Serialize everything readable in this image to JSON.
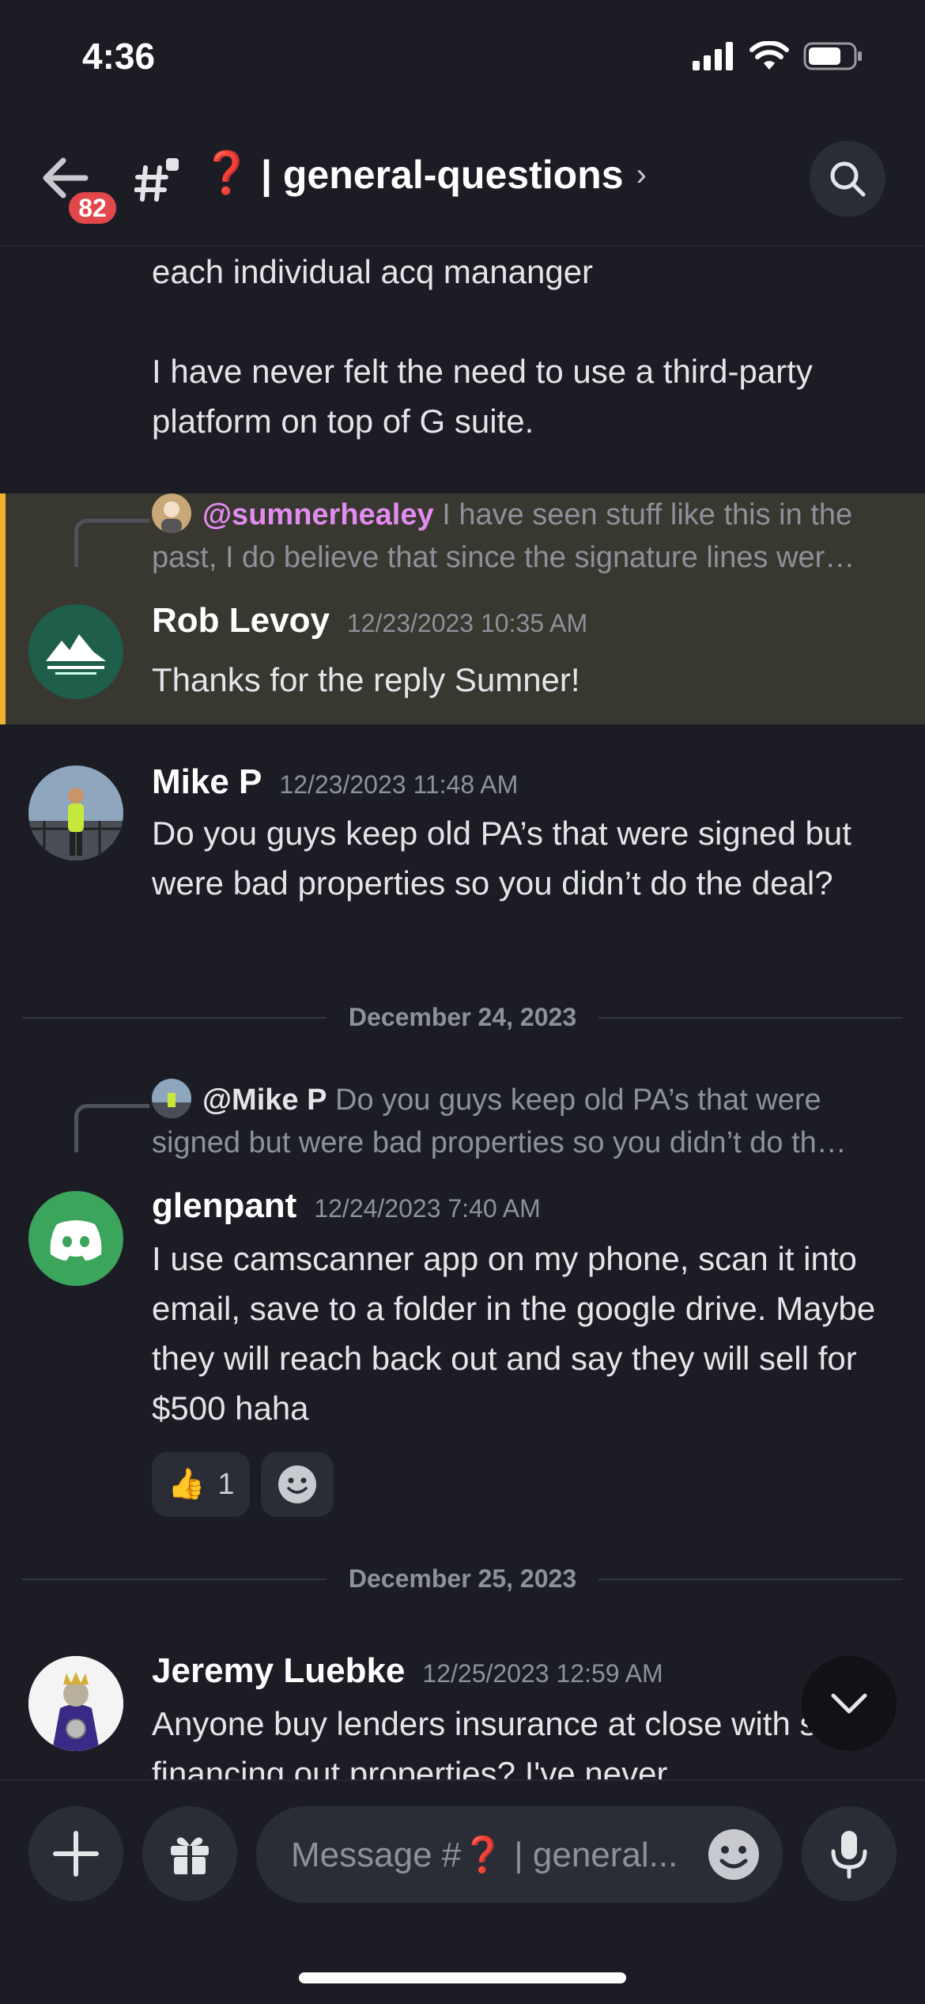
{
  "status_bar": {
    "time": "4:36"
  },
  "header": {
    "unread_badge": "82",
    "channel_emoji": "❓",
    "channel_name": "| general-questions",
    "chevron": "›"
  },
  "messages": {
    "top_cont_line1": "each individual acq mananger",
    "top_cont_line3": "I have never felt the need to use a third-party platform on top of G suite.",
    "m1": {
      "reply_mention": "@sumnerhealey",
      "reply_text": " I have seen stuff like this in the past, I do believe that since the signature lines wer…",
      "author": "Rob Levoy",
      "timestamp": "12/23/2023 10:35 AM",
      "body": "Thanks for the reply Sumner!"
    },
    "m2": {
      "author": "Mike P",
      "timestamp": "12/23/2023 11:48 AM",
      "body": "Do you guys keep old PA’s that were signed but were bad properties so you didn’t do the deal?"
    },
    "date1": "December 24, 2023",
    "m3": {
      "reply_mention": "@Mike P",
      "reply_text": " Do you guys keep old PA’s that were signed but were bad properties so you didn’t do th…",
      "author": "glenpant",
      "timestamp": "12/24/2023 7:40 AM",
      "body": "I use camscanner app on my phone, scan it into email, save to a folder in the google drive. Maybe they will  reach back out and say they will sell for $500 haha",
      "reaction_emoji": "👍",
      "reaction_count": "1"
    },
    "date2": "December 25, 2023",
    "m4": {
      "author": "Jeremy Luebke",
      "timestamp": "12/25/2023 12:59 AM",
      "body": "Anyone buy lenders insurance at close with seller financing out properties? I've never"
    }
  },
  "composer": {
    "placeholder": "Message #❓ | general..."
  },
  "colors": {
    "background": "#1c1d24",
    "highlight": "#383730",
    "highlight_border": "#f0b232",
    "mention": "#e28cf0",
    "badge": "#e2474a",
    "discord_green": "#3ba55c"
  },
  "icons": [
    "back-arrow-icon",
    "channel-thread-icon",
    "search-icon",
    "discord-logo-icon",
    "add-reaction-icon",
    "chevron-down-icon",
    "plus-icon",
    "gift-icon",
    "emoji-icon",
    "microphone-icon",
    "signal-icon",
    "wifi-icon",
    "battery-icon"
  ]
}
